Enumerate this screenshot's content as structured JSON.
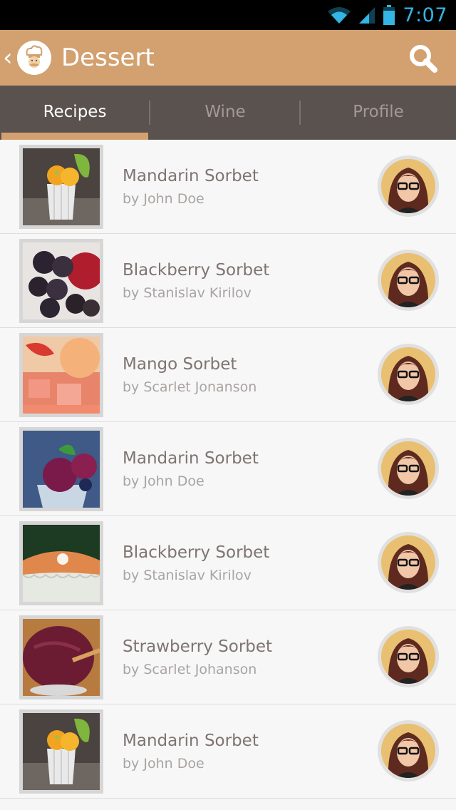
{
  "status_bar": {
    "time": "7:07",
    "icons": [
      "wifi-icon",
      "signal-icon",
      "battery-icon"
    ],
    "accent_color": "#33b5e5"
  },
  "action_bar": {
    "title": "Dessert",
    "back_icon": "chevron-left-icon",
    "logo_icon": "chef-icon",
    "search_icon": "search-icon",
    "color": "#d2a16f"
  },
  "tabs": [
    {
      "label": "Recipes",
      "active": true
    },
    {
      "label": "Wine",
      "active": false
    },
    {
      "label": "Profile",
      "active": false
    }
  ],
  "recipes": [
    {
      "title": "Mandarin Sorbet",
      "author": "by John Doe"
    },
    {
      "title": "Blackberry Sorbet",
      "author": "by Stanislav Kirilov"
    },
    {
      "title": "Mango Sorbet",
      "author": "by Scarlet Jonanson"
    },
    {
      "title": "Mandarin Sorbet",
      "author": "by John Doe"
    },
    {
      "title": "Blackberry Sorbet",
      "author": "by Stanislav Kirilov"
    },
    {
      "title": "Strawberry Sorbet",
      "author": "by Scarlet Johanson"
    },
    {
      "title": "Mandarin Sorbet",
      "author": "by John Doe"
    }
  ]
}
